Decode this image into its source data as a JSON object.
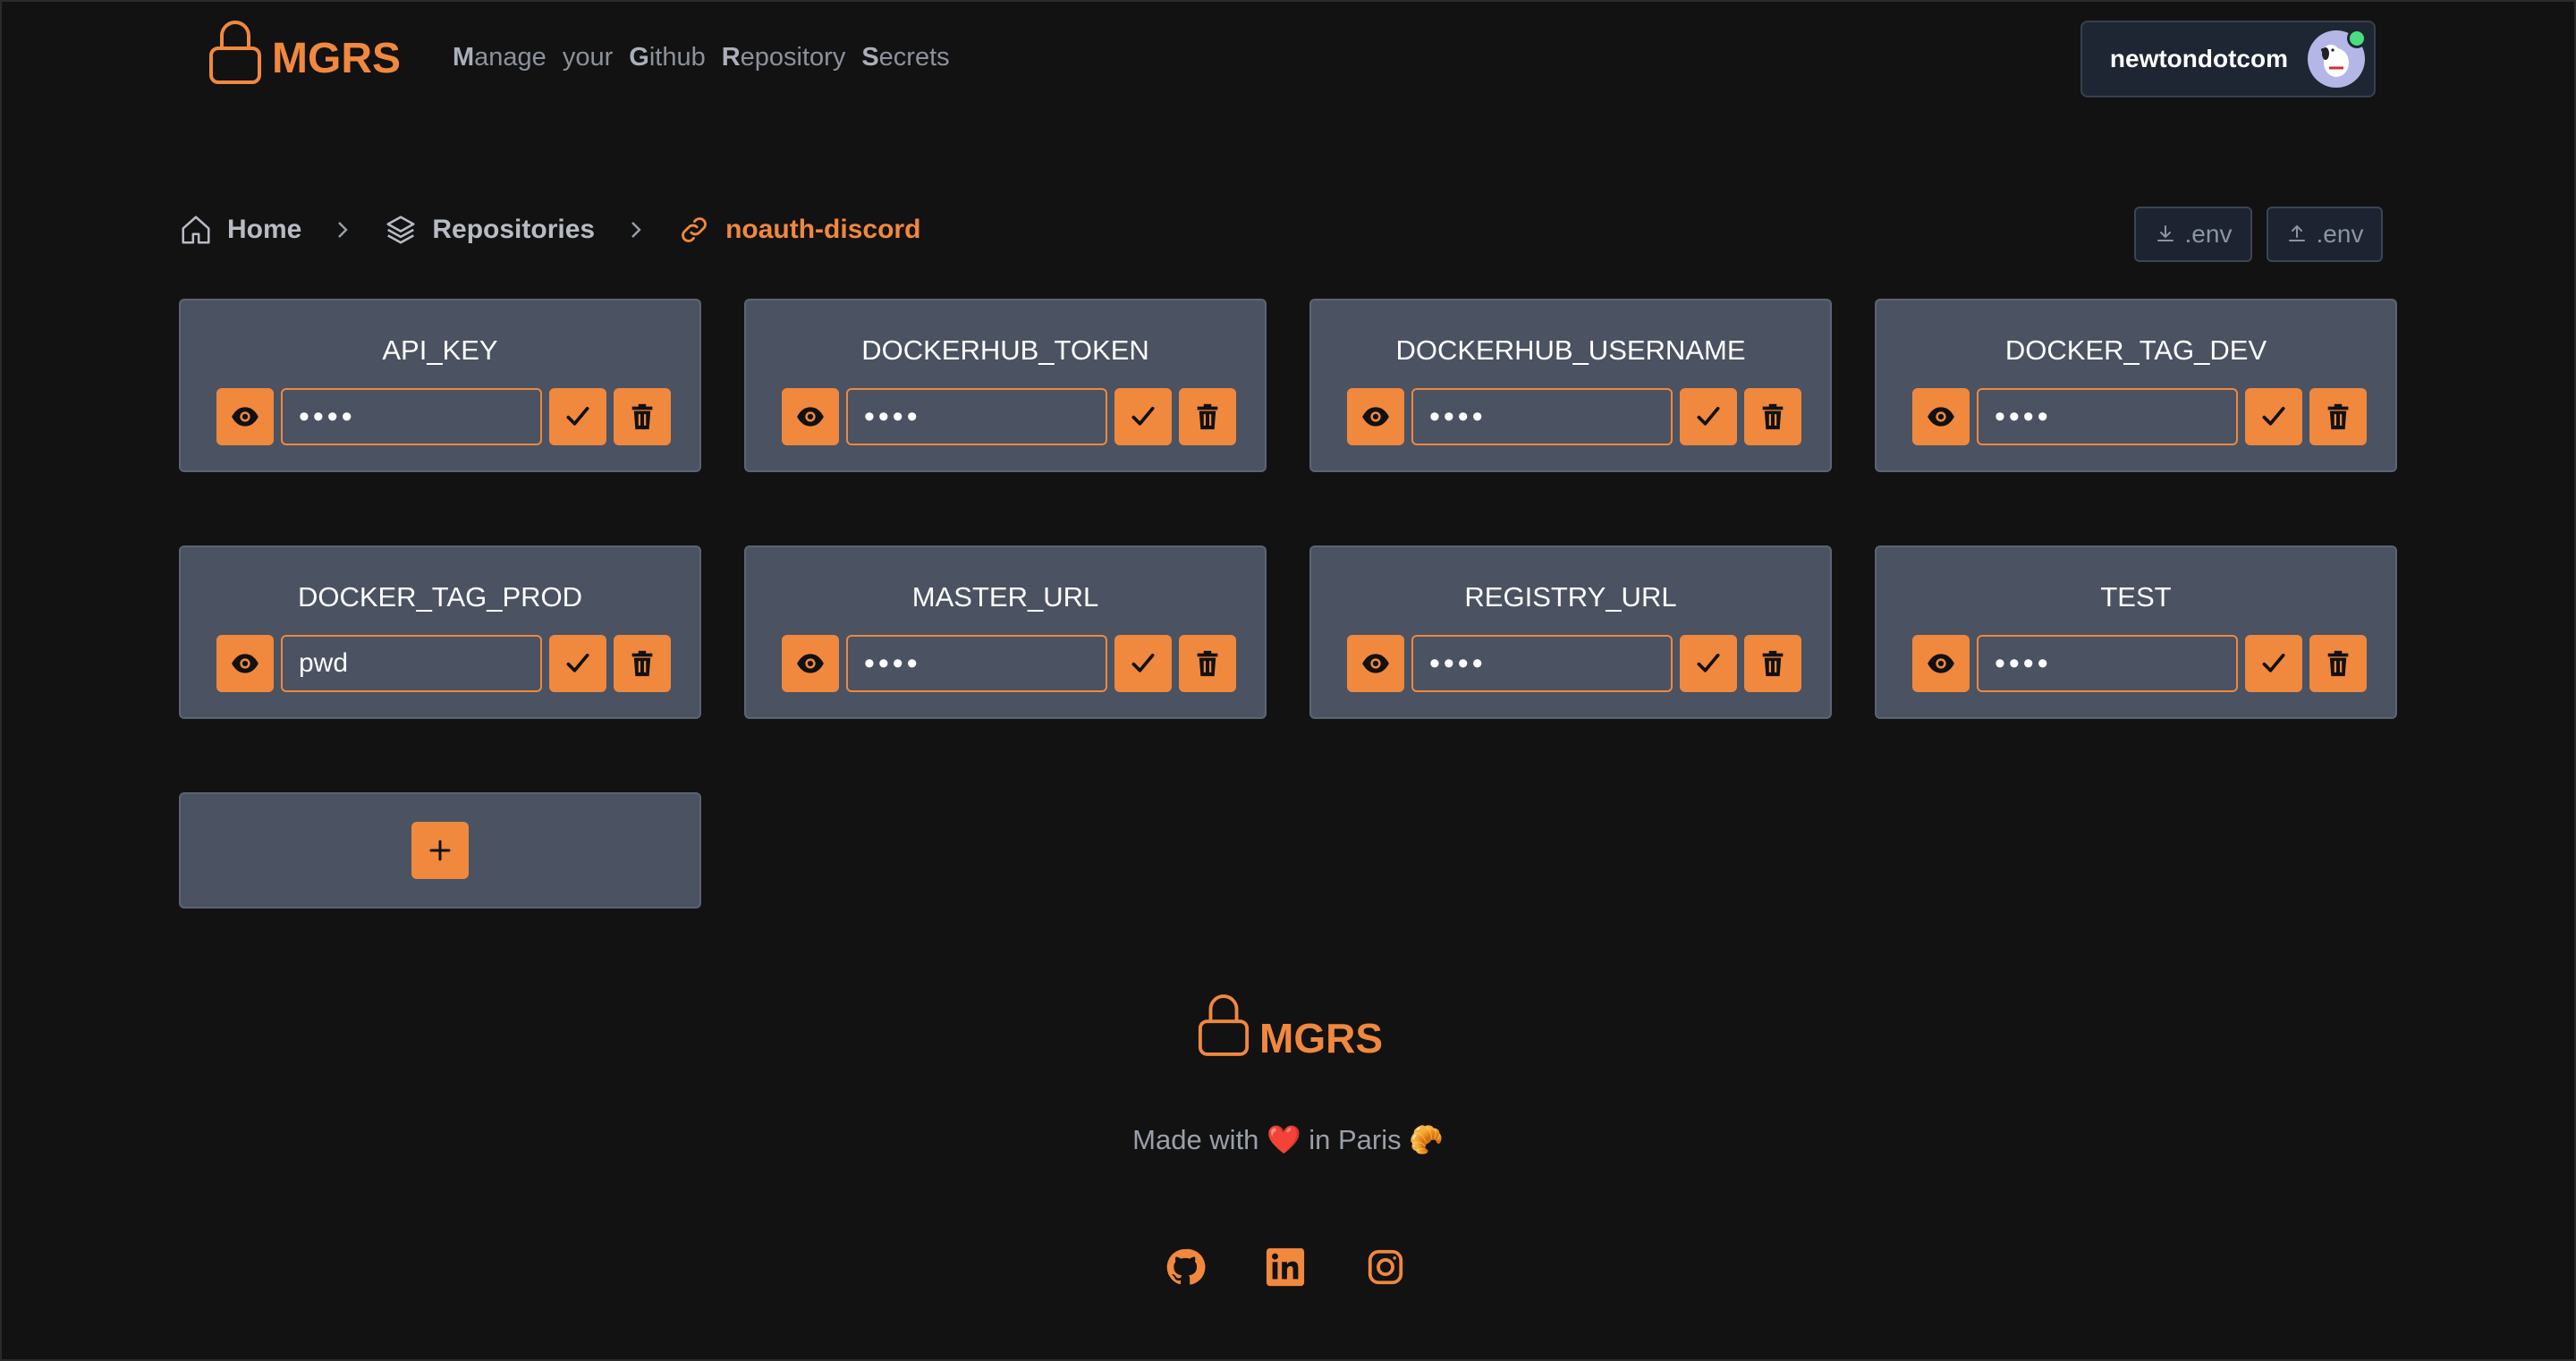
{
  "header": {
    "brand": "MGRS",
    "tagline": [
      {
        "initial": "M",
        "rest": "anage"
      },
      {
        "initial": "",
        "rest": "your"
      },
      {
        "initial": "G",
        "rest": "ithub"
      },
      {
        "initial": "R",
        "rest": "epository"
      },
      {
        "initial": "S",
        "rest": "ecrets"
      }
    ],
    "username": "newtondotcom"
  },
  "breadcrumb": {
    "home": "Home",
    "repositories": "Repositories",
    "current": "noauth-discord"
  },
  "env_buttons": {
    "download_label": ".env",
    "upload_label": ".env"
  },
  "secrets": [
    {
      "name": "API_KEY",
      "value": "••••"
    },
    {
      "name": "DOCKERHUB_TOKEN",
      "value": "••••"
    },
    {
      "name": "DOCKERHUB_USERNAME",
      "value": "••••"
    },
    {
      "name": "DOCKER_TAG_DEV",
      "value": "••••"
    },
    {
      "name": "DOCKER_TAG_PROD",
      "value": "pwd"
    },
    {
      "name": "MASTER_URL",
      "value": "••••"
    },
    {
      "name": "REGISTRY_URL",
      "value": "••••"
    },
    {
      "name": "TEST",
      "value": "••••"
    }
  ],
  "footer": {
    "brand": "MGRS",
    "made_with": "Made with ❤️ in Paris 🥐"
  },
  "colors": {
    "accent": "#f0883e",
    "background": "#121212",
    "card": "#4b5261"
  },
  "icons": [
    "lock-icon",
    "home-icon",
    "layers-icon",
    "link-icon",
    "eye-icon",
    "check-icon",
    "trash-icon",
    "plus-icon",
    "download-icon",
    "upload-icon",
    "github-icon",
    "linkedin-icon",
    "instagram-icon"
  ]
}
